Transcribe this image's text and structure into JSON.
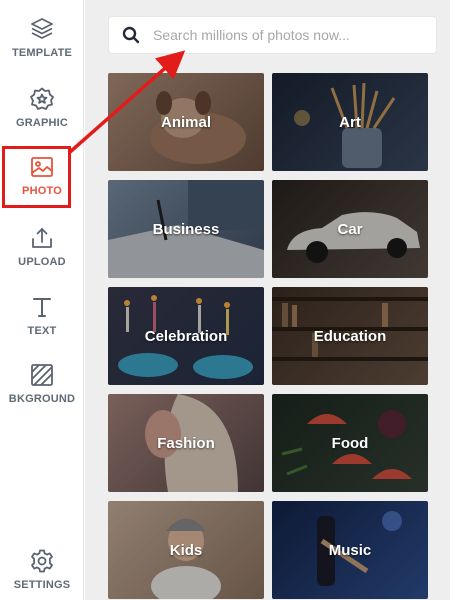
{
  "sidebar": {
    "items": [
      {
        "label": "TEMPLATE",
        "icon": "layers-icon"
      },
      {
        "label": "GRAPHIC",
        "icon": "star-badge-icon"
      },
      {
        "label": "PHOTO",
        "icon": "image-icon",
        "active": true
      },
      {
        "label": "UPLOAD",
        "icon": "upload-icon"
      },
      {
        "label": "TEXT",
        "icon": "text-t-icon"
      },
      {
        "label": "BKGROUND",
        "icon": "background-icon"
      }
    ],
    "settings_label": "SETTINGS",
    "accent_color": "#e8523c"
  },
  "search": {
    "placeholder": "Search millions of photos now...",
    "value": ""
  },
  "categories": [
    {
      "label": "Animal",
      "color": "#8a6a55"
    },
    {
      "label": "Art",
      "color": "#2c3a4e"
    },
    {
      "label": "Business",
      "color": "#5b6f85"
    },
    {
      "label": "Car",
      "color": "#3a3330"
    },
    {
      "label": "Celebration",
      "color": "#3b3f55"
    },
    {
      "label": "Education",
      "color": "#4a3a2e"
    },
    {
      "label": "Fashion",
      "color": "#8c6e6a"
    },
    {
      "label": "Food",
      "color": "#233028"
    },
    {
      "label": "Kids",
      "color": "#b49a88"
    },
    {
      "label": "Music",
      "color": "#1f3560"
    }
  ]
}
